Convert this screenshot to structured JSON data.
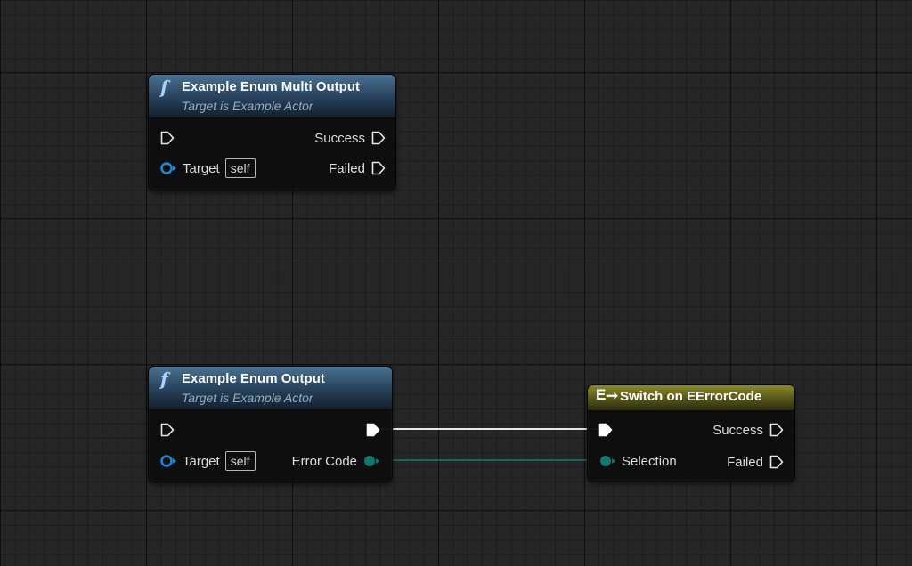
{
  "nodes": {
    "multi_output": {
      "title": "Example Enum Multi Output",
      "subtitle": "Target is Example Actor",
      "pins": {
        "success": "Success",
        "failed": "Failed",
        "target": "Target",
        "target_default": "self"
      }
    },
    "enum_output": {
      "title": "Example Enum Output",
      "subtitle": "Target is Example Actor",
      "pins": {
        "target": "Target",
        "target_default": "self",
        "error_code": "Error Code"
      }
    },
    "switch": {
      "title": "Switch on EErrorCode",
      "pins": {
        "success": "Success",
        "failed": "Failed",
        "selection": "Selection"
      }
    }
  },
  "icons": {
    "function": "function-icon",
    "switch": "switch-enum-icon",
    "exec_pin": "exec-pin-icon",
    "object_pin": "object-pin-icon",
    "enum_pin": "enum-pin-icon"
  },
  "colors": {
    "grid_background": "#262626",
    "function_header": "#2b4863",
    "switch_header": "#55551a",
    "object_pin": "#1a8ed8",
    "enum_pin": "#0e7a6e",
    "exec_wire": "#e6e6e6"
  }
}
